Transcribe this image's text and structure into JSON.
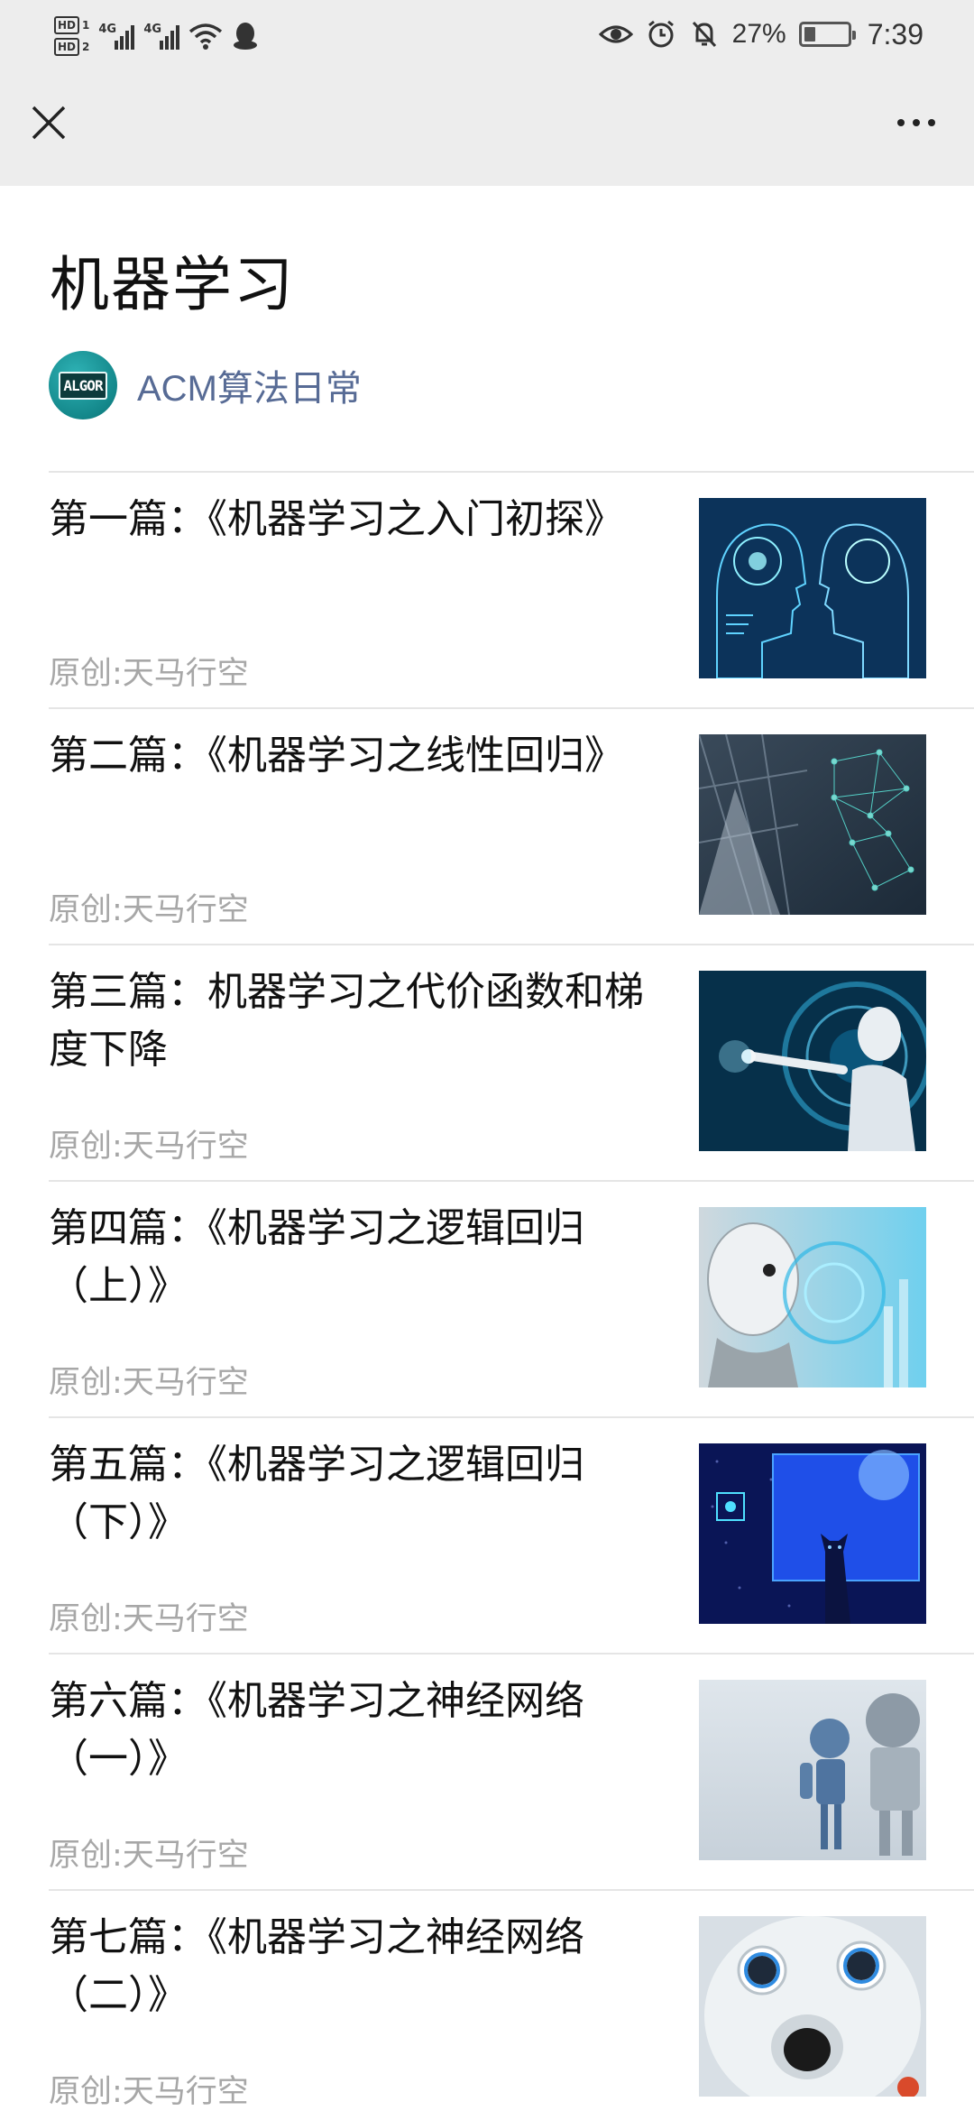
{
  "status_bar": {
    "hd1": "HD",
    "hd1_sub": "1",
    "hd2": "HD",
    "hd2_sub": "2",
    "net1": "4G",
    "net2": "4G",
    "battery_percent": "27%",
    "battery_level": 0.27,
    "time": "7:39"
  },
  "nav": {
    "close_icon": "close-icon",
    "more_icon": "more-icon"
  },
  "page": {
    "title": "机器学习",
    "account_name": "ACM算法日常",
    "avatar_text": "ALGOR"
  },
  "articles": [
    {
      "title": "第一篇：《机器学习之入门初探》",
      "source": "原创:天马行空",
      "thumb": "brain-ai-thumbnail"
    },
    {
      "title": "第二篇：《机器学习之线性回归》",
      "source": "原创:天马行空",
      "thumb": "network-city-thumbnail"
    },
    {
      "title": "第三篇：机器学习之代价函数和梯度下降",
      "source": "原创:天马行空",
      "thumb": "robot-hand-thumbnail"
    },
    {
      "title": "第四篇：《机器学习之逻辑回归（上）》",
      "source": "原创:天马行空",
      "thumb": "robot-face-thumbnail"
    },
    {
      "title": "第五篇：《机器学习之逻辑回归（下）》",
      "source": "原创:天马行空",
      "thumb": "cat-screen-thumbnail"
    },
    {
      "title": "第六篇：《机器学习之神经网络（一）》",
      "source": "原创:天马行空",
      "thumb": "toy-robots-thumbnail"
    },
    {
      "title": "第七篇：《机器学习之神经网络（二）》",
      "source": "原创:天马行空",
      "thumb": "round-robot-thumbnail"
    }
  ],
  "colors": {
    "top_background": "#ededed",
    "account_link": "#576b95",
    "meta_text": "#a7a7a7",
    "divider": "#e5e5e5"
  }
}
